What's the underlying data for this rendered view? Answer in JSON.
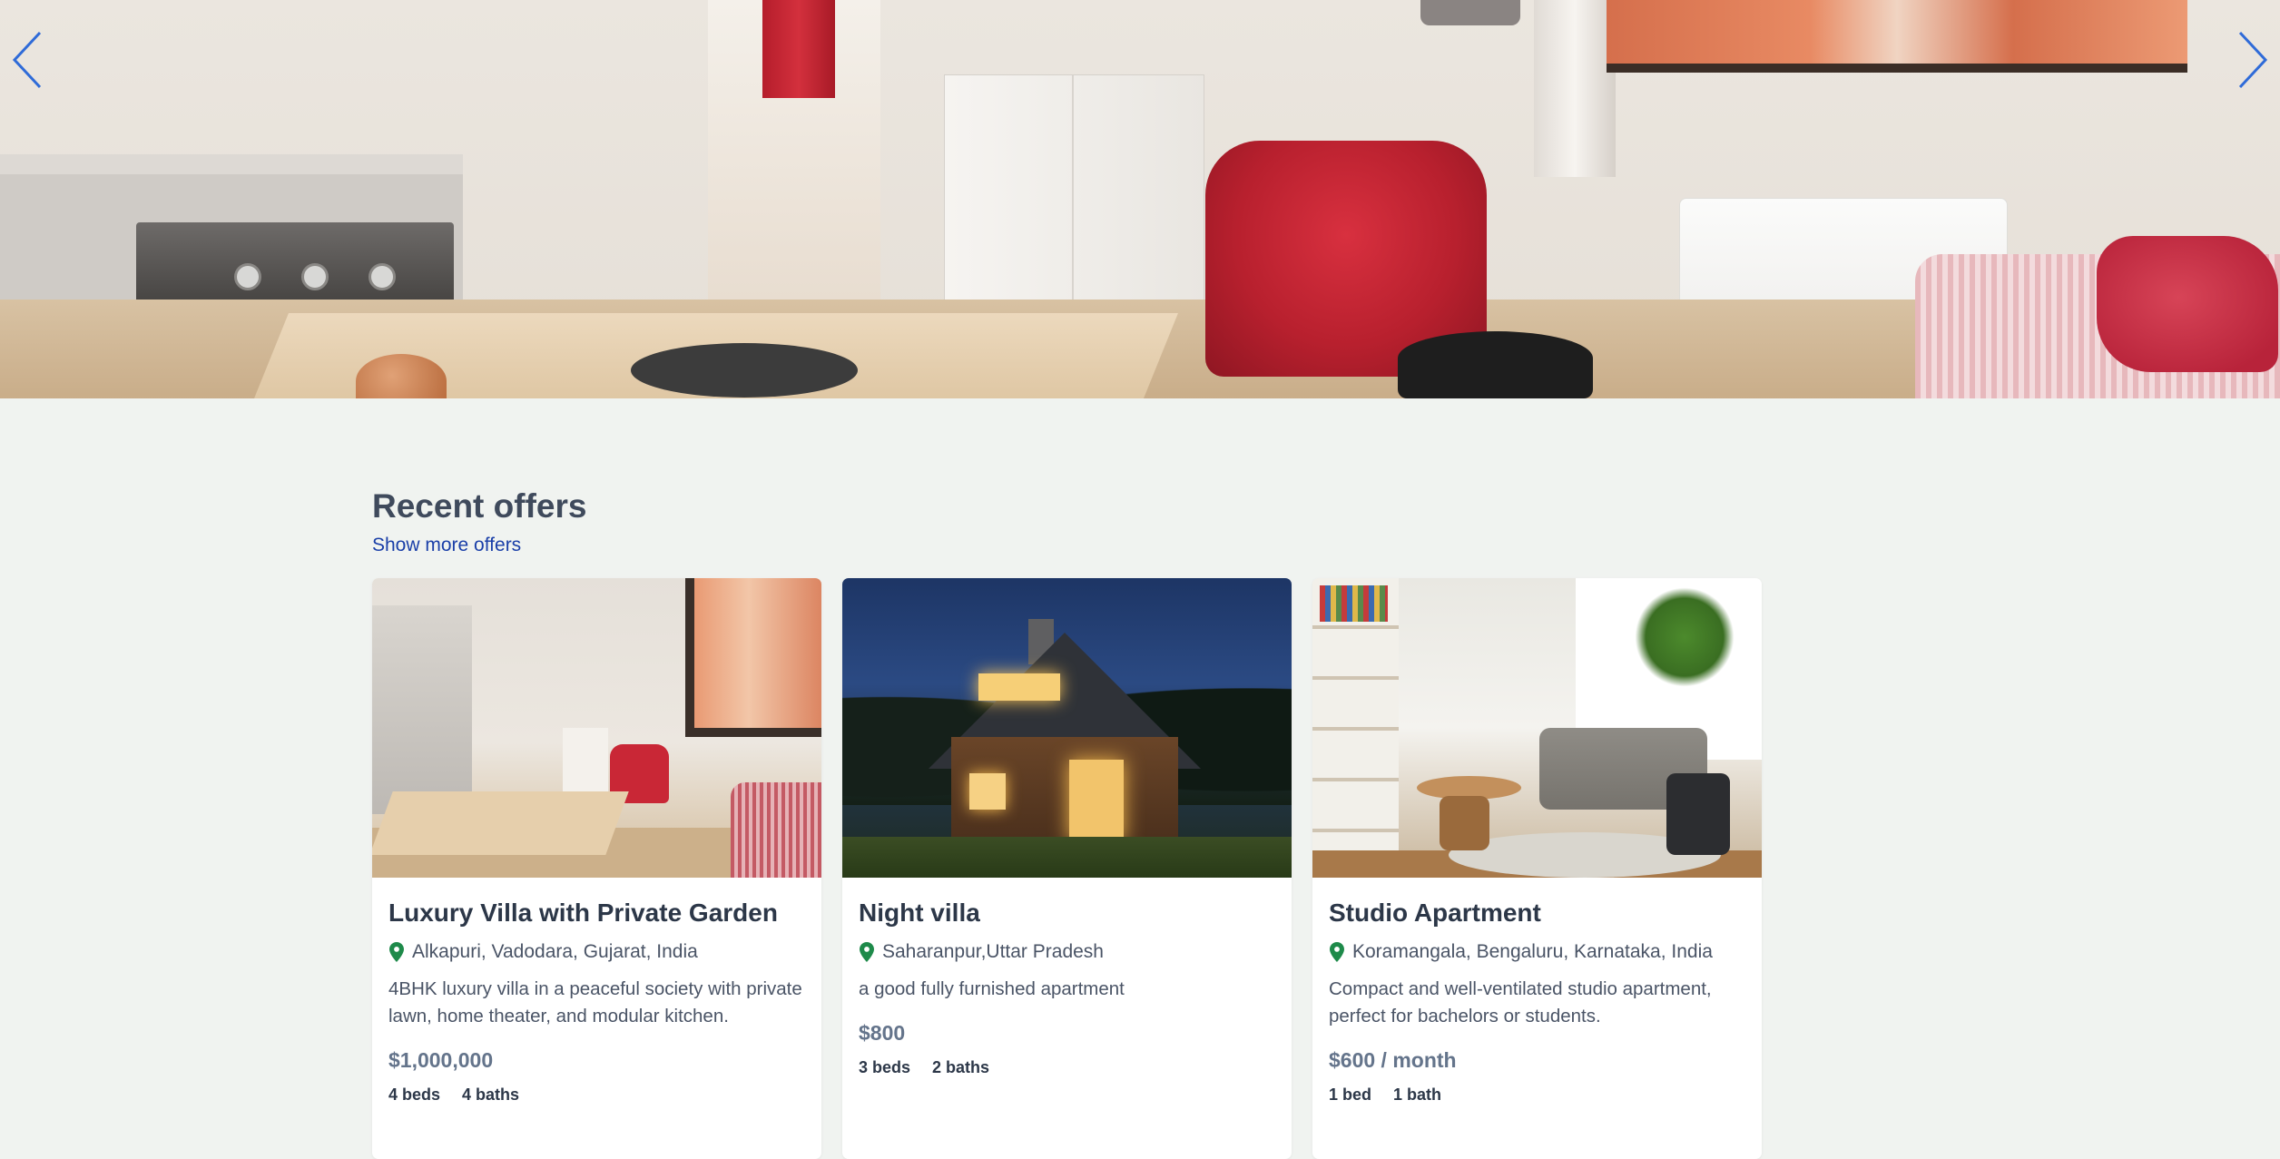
{
  "hero": {
    "prev_icon": "chevron-left-icon",
    "next_icon": "chevron-right-icon",
    "arrow_color": "#2f6bd8"
  },
  "offers": {
    "heading": "Recent offers",
    "more_link": "Show more offers",
    "location_icon_color": "#1e8a4a",
    "cards": [
      {
        "title": "Luxury Villa with Private Garden",
        "location": "Alkapuri, Vadodara, Gujarat, India",
        "description": "4BHK luxury villa in a peaceful society with private lawn, home theater, and modular kitchen.",
        "price": "$1,000,000",
        "beds": "4 beds",
        "baths": "4 baths"
      },
      {
        "title": "Night villa",
        "location": "Saharanpur,Uttar Pradesh",
        "description": "a good fully furnished apartment",
        "price": "$800",
        "beds": "3 beds",
        "baths": "2 baths"
      },
      {
        "title": "Studio Apartment",
        "location": "Koramangala, Bengaluru, Karnataka, India",
        "description": "Compact and well-ventilated studio apartment, perfect for bachelors or students.",
        "price": "$600 / month",
        "beds": "1 bed",
        "baths": "1 bath"
      }
    ]
  }
}
